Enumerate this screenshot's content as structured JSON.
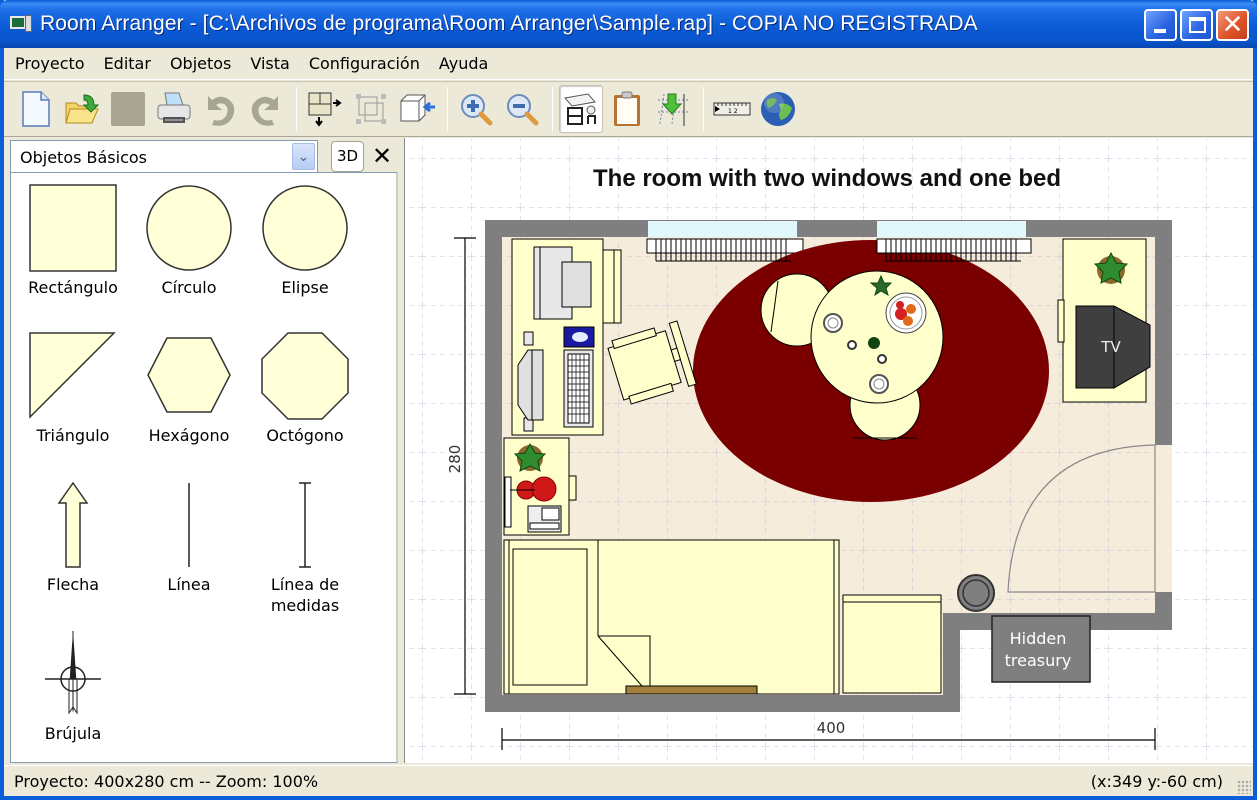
{
  "window": {
    "title": "Room Arranger - [C:\\Archivos de programa\\Room Arranger\\Sample.rap] - COPIA NO REGISTRADA",
    "buttons": {
      "minimize": "minimize",
      "maximize": "maximize",
      "close": "✕"
    }
  },
  "menu": [
    "Proyecto",
    "Editar",
    "Objetos",
    "Vista",
    "Configuración",
    "Ayuda"
  ],
  "toolbar": {
    "groups": [
      [
        "new-document-icon",
        "open-folder-icon",
        "save-icon",
        "print-icon",
        "undo-icon",
        "redo-icon"
      ],
      [
        "room-resize-icon",
        "select-all-icon",
        "import-object-icon"
      ],
      [
        "zoom-in-icon",
        "zoom-out-icon"
      ],
      [
        "room-view-icon",
        "clipboard-icon",
        "align-grid-icon"
      ],
      [
        "ruler-icon",
        "globe-icon"
      ]
    ],
    "pressed": "room-view-icon"
  },
  "left_panel": {
    "category": "Objetos Básicos",
    "btn_3d": "3D",
    "btn_close": "✕",
    "items": [
      {
        "label": "Rectángulo",
        "shape": "rect"
      },
      {
        "label": "Círculo",
        "shape": "circle"
      },
      {
        "label": "Elipse",
        "shape": "ellipse"
      },
      {
        "label": "Triángulo",
        "shape": "triangle"
      },
      {
        "label": "Hexágono",
        "shape": "hexagon"
      },
      {
        "label": "Octógono",
        "shape": "octagon"
      },
      {
        "label": "Flecha",
        "shape": "arrow"
      },
      {
        "label": "Línea",
        "shape": "line"
      },
      {
        "label": "Línea de medidas",
        "shape": "measure-line"
      },
      {
        "label": "Brújula",
        "shape": "compass"
      }
    ]
  },
  "canvas": {
    "title": "The room with two windows and one bed",
    "dim_width": "400",
    "dim_height": "280",
    "tv_label": "TV",
    "hidden_label_1": "Hidden",
    "hidden_label_2": "treasury"
  },
  "colors": {
    "wall": "#7f7f7f",
    "floor": "#f5ecdc",
    "furniture": "#ffffcc",
    "rug": "#7a0000",
    "window_glass": "#e0f8fc",
    "tv": "#3f3f3f",
    "plant": "#2e8b2e",
    "grid": "#c8c4dc"
  },
  "status": {
    "left": "Proyecto: 400x280 cm -- Zoom: 100%",
    "right": "(x:349 y:-60 cm)"
  }
}
